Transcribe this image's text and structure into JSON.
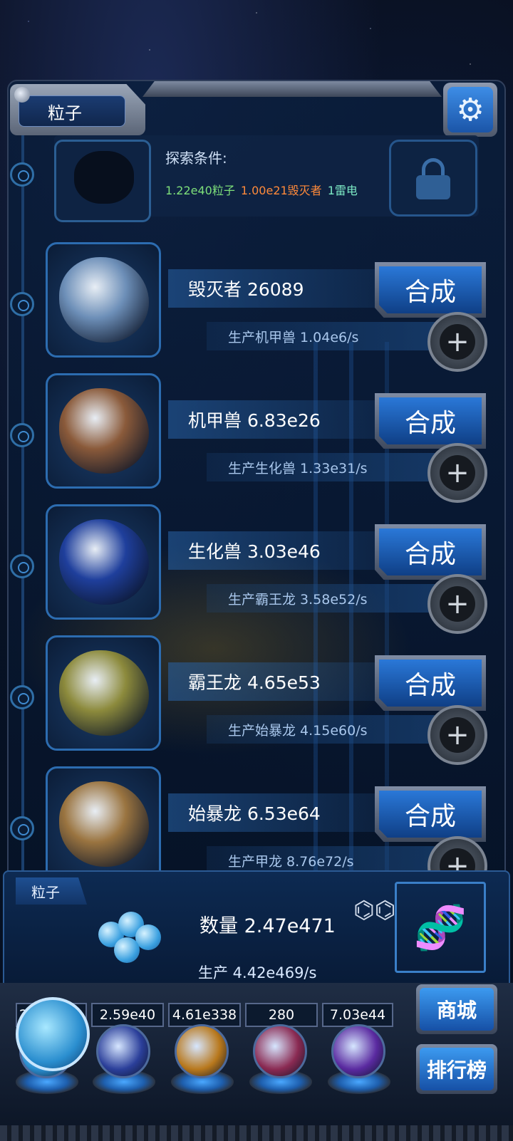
{
  "header": {
    "title": "粒子",
    "settings_icon": "gear-icon"
  },
  "locked": {
    "cond_title": "探索条件:",
    "cond": [
      {
        "text": "1.22e40粒子",
        "color": "#7ee07a"
      },
      {
        "text": "1.00e21毁灭者",
        "color": "#ff8a3a"
      },
      {
        "text": "1雷电",
        "color": "#7ce9c4"
      }
    ]
  },
  "rows": [
    {
      "name": "毁灭者 26089",
      "prod": "生产机甲兽 1.04e6/s",
      "btn": "合成",
      "tint": "#6d8fb8"
    },
    {
      "name": "机甲兽 6.83e26",
      "prod": "生产生化兽 1.33e31/s",
      "btn": "合成",
      "tint": "#8a5a3a"
    },
    {
      "name": "生化兽 3.03e46",
      "prod": "生产霸王龙 3.58e52/s",
      "btn": "合成",
      "tint": "#1f3f9c"
    },
    {
      "name": "霸王龙 4.65e53",
      "prod": "生产始暴龙 4.15e60/s",
      "btn": "合成",
      "tint": "#8c8a3c"
    },
    {
      "name": "始暴龙 6.53e64",
      "prod": "生产甲龙 8.76e72/s",
      "btn": "合成",
      "tint": "#9a7440"
    }
  ],
  "info": {
    "tab": "粒子",
    "qty": "数量 2.47e471",
    "prod": "生产 4.42e469/s"
  },
  "resources": [
    "2.47e471",
    "2.59e40",
    "4.61e338",
    "280",
    "7.03e44"
  ],
  "side": {
    "shop": "商城",
    "rank": "排行榜"
  },
  "orbs": [
    {
      "name": "particle-orb",
      "color": "#2a8ecf"
    },
    {
      "name": "lightning-orb",
      "color": "#2b3f9a"
    },
    {
      "name": "fire-orb",
      "color": "#b8781c"
    },
    {
      "name": "brain-orb",
      "color": "#8a2a52"
    },
    {
      "name": "vortex-orb",
      "color": "#5a2aa0"
    }
  ]
}
